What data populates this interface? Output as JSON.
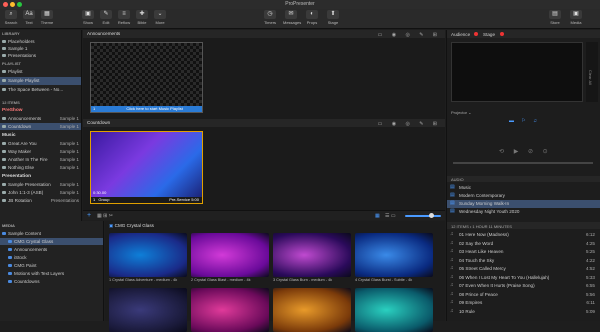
{
  "window": {
    "title": "ProPresenter"
  },
  "toolbar": {
    "left": [
      {
        "label": "Search",
        "icon": "⌕"
      },
      {
        "label": "Text",
        "icon": "Aa"
      },
      {
        "label": "Theme",
        "icon": "▦"
      }
    ],
    "center": [
      {
        "label": "Show",
        "icon": "▣"
      },
      {
        "label": "Edit",
        "icon": "✎"
      },
      {
        "label": "Reflow",
        "icon": "≡"
      },
      {
        "label": "Bible",
        "icon": "✚"
      },
      {
        "label": "More",
        "icon": "⌄"
      }
    ],
    "mid": [
      {
        "label": "Timers",
        "icon": "◷"
      },
      {
        "label": "Messages",
        "icon": "✉"
      },
      {
        "label": "Props",
        "icon": "◐"
      },
      {
        "label": "Stage",
        "icon": "⬆"
      }
    ],
    "right": [
      {
        "label": "Store",
        "icon": "▤"
      },
      {
        "label": "Media",
        "icon": "▣"
      }
    ]
  },
  "library": {
    "header": "LIBRARY",
    "items": [
      "Placeholders",
      "Sample 1",
      "Presentations"
    ],
    "playlist_header": "PLAYLIST",
    "playlists": [
      "Playlist",
      "Sample Playlist",
      "The Space Between - No..."
    ]
  },
  "items_header": "12 ITEMS",
  "playlist_groups": [
    {
      "name": "PreShow",
      "color": "red",
      "rows": [
        {
          "label": "Announcements",
          "lib": "Sample 1",
          "sel": false
        },
        {
          "label": "Countdown",
          "lib": "Sample 1",
          "sel": true
        }
      ]
    },
    {
      "name": "Music",
      "color": "white",
      "rows": [
        {
          "label": "Great Are You",
          "lib": "Sample 1",
          "sel": false
        },
        {
          "label": "Way Maker",
          "lib": "Sample 1",
          "sel": false
        },
        {
          "label": "Another In The Fire",
          "lib": "Sample 1",
          "sel": false
        },
        {
          "label": "Nothing Else",
          "lib": "Sample 1",
          "sel": false
        }
      ]
    },
    {
      "name": "Presentation",
      "color": "white",
      "rows": [
        {
          "label": "Sample Presentation",
          "lib": "Sample 1",
          "sel": false
        },
        {
          "label": "John 1:1-3 (ASB)",
          "lib": "Sample 1",
          "sel": false
        },
        {
          "label": "JB Rotation",
          "lib": "Presentations",
          "sel": false
        }
      ]
    }
  ],
  "panes": {
    "announcements": {
      "title": "Announcements",
      "slide_text": "Click here to start Music Playlist",
      "slide_num": "1"
    },
    "countdown": {
      "title": "Countdown",
      "slide_num": "1",
      "group": "Group",
      "time": "0:30.00",
      "label": "Pre-Service 5:00"
    }
  },
  "media": {
    "header": "MEDIA",
    "tree": [
      {
        "label": "Sample Content",
        "indent": 0,
        "sel": false
      },
      {
        "label": "CMG Crystal Glass",
        "indent": 1,
        "sel": true
      },
      {
        "label": "Announcements",
        "indent": 1,
        "sel": false
      },
      {
        "label": "iStock",
        "indent": 1,
        "sel": false
      },
      {
        "label": "CMG Paint",
        "indent": 1,
        "sel": false
      },
      {
        "label": "Motions with Text Layers",
        "indent": 1,
        "sel": false
      },
      {
        "label": "Countdowns",
        "indent": 1,
        "sel": false
      }
    ],
    "folder_title": "CMG Crystal Glass",
    "thumbs": [
      {
        "caption": "1 Crystal Glass Adventure - medium - 4k",
        "c1": "#1a2a88",
        "c2": "#0e7fd8"
      },
      {
        "caption": "2 Crystal Glass Blast - medium - 4k",
        "c1": "#6a0a9a",
        "c2": "#d23ad8"
      },
      {
        "caption": "3 Crystal Glass Burn - medium - 4k",
        "c1": "#2a0a5a",
        "c2": "#c04ad0"
      },
      {
        "caption": "4 Crystal Glass Burst - Subtle - 4k",
        "c1": "#0a2a80",
        "c2": "#3a8ae8"
      },
      {
        "caption": "",
        "c1": "#1a1a3a",
        "c2": "#3a3a7a"
      },
      {
        "caption": "",
        "c1": "#6a0a5a",
        "c2": "#e03a9a"
      },
      {
        "caption": "",
        "c1": "#7a3a0a",
        "c2": "#e89a2a"
      },
      {
        "caption": "",
        "c1": "#0a5a6a",
        "c2": "#2ad0c0"
      }
    ]
  },
  "right": {
    "audience_label": "Audience",
    "stage_label": "Stage",
    "projector_label": "Projector",
    "clear_label": "Clear All",
    "audio_header": "AUDIO",
    "audio_items": [
      {
        "label": "Music",
        "sel": false
      },
      {
        "label": "Modern Contemporary",
        "sel": false
      },
      {
        "label": "Sunday Morning Walk-In",
        "sel": true
      },
      {
        "label": "Wednesday Night Youth 2020",
        "sel": false
      }
    ],
    "songs_header": "12 ITEMS • 1 HOUR 11 MINUTES",
    "songs": [
      {
        "num": "01",
        "title": "Here Now (Madness)",
        "time": "6:12"
      },
      {
        "num": "02",
        "title": "Say the Word",
        "time": "4:25"
      },
      {
        "num": "03",
        "title": "Heart Like Heaven",
        "time": "5:25"
      },
      {
        "num": "04",
        "title": "Touch the Sky",
        "time": "4:22"
      },
      {
        "num": "05",
        "title": "Street Called Mercy",
        "time": "4:52"
      },
      {
        "num": "06",
        "title": "When I Lost My Heart To You (Hallelujah)",
        "time": "5:33"
      },
      {
        "num": "07",
        "title": "Even When It Hurts (Praise Song)",
        "time": "6:55"
      },
      {
        "num": "08",
        "title": "Prince of Peace",
        "time": "5:56"
      },
      {
        "num": "09",
        "title": "Empires",
        "time": "6:11"
      },
      {
        "num": "10",
        "title": "Rule",
        "time": "5:09"
      }
    ]
  }
}
